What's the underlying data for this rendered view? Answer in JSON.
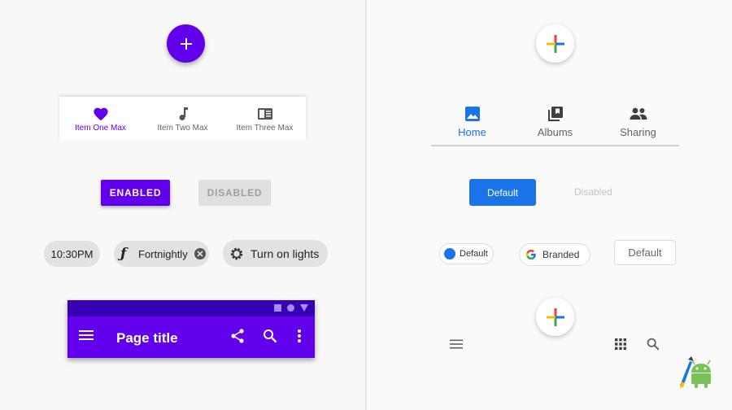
{
  "left": {
    "bottom_nav": {
      "items": [
        {
          "label": "Item One Max",
          "icon": "heart-icon",
          "active": true
        },
        {
          "label": "Item Two Max",
          "icon": "music-note-icon",
          "active": false
        },
        {
          "label": "Item Three Max",
          "icon": "book-icon",
          "active": false
        }
      ]
    },
    "buttons": {
      "enabled_label": "ENABLED",
      "disabled_label": "DISABLED"
    },
    "chips": {
      "time": "10:30PM",
      "fortnightly": "Fortnightly",
      "lights": "Turn on lights"
    },
    "app_bar": {
      "title": "Page title"
    }
  },
  "right": {
    "tabs": [
      {
        "label": "Home",
        "icon": "image-icon",
        "active": true
      },
      {
        "label": "Albums",
        "icon": "photo-library-icon",
        "active": false
      },
      {
        "label": "Sharing",
        "icon": "people-icon",
        "active": false
      }
    ],
    "buttons": {
      "default_label": "Default",
      "disabled_label": "Disabled"
    },
    "chips": {
      "default": "Default",
      "branded": "Branded",
      "outlined": "Default"
    }
  },
  "colors": {
    "material_primary": "#6200ee",
    "material_primary_dark": "#3700b3",
    "google_blue": "#1a73e8",
    "google_red": "#ea4335",
    "google_yellow": "#fbbc04",
    "google_green": "#34a853"
  }
}
